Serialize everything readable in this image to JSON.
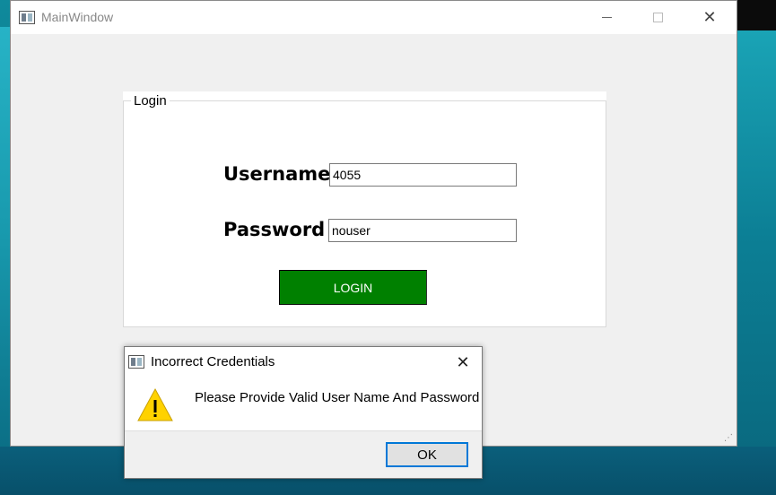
{
  "main_window": {
    "title": "MainWindow",
    "controls": {
      "minimize_icon": "minimize-icon",
      "maximize_icon": "maximize-icon",
      "close_glyph": "✕"
    }
  },
  "login_group": {
    "legend": "Login",
    "username_label": "Username",
    "username_value": "4055",
    "password_label": "Password",
    "password_value": "nouser",
    "login_button": "LOGIN",
    "login_button_color": "#008000"
  },
  "dialog": {
    "title": "Incorrect Credentials",
    "close_glyph": "✕",
    "icon": "warning-icon",
    "message": "Please Provide Valid User Name And Password",
    "ok_button": "OK",
    "ok_focus_color": "#0078d7"
  }
}
